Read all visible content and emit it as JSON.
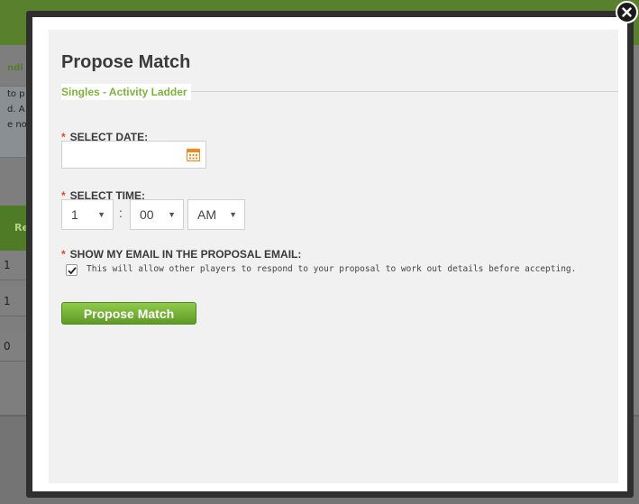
{
  "background": {
    "heading_fragment": "ndi",
    "text_fragments": [
      "to p",
      "d. A",
      "e no"
    ],
    "table_header_fragment": "Re",
    "row_values": [
      "1",
      "1",
      "0"
    ]
  },
  "modal": {
    "title": "Propose Match",
    "subtitle": "Singles - Activity Ladder",
    "date_label": "SELECT DATE:",
    "date_value": "",
    "time_label": "SELECT TIME:",
    "hour_value": "1",
    "minute_value": "00",
    "time_separator": ":",
    "ampm_value": "AM",
    "email_label": "SHOW MY EMAIL IN THE PROPOSAL EMAIL:",
    "email_checked": true,
    "email_note": "This will allow other players to respond to your proposal to work out details before accepting.",
    "submit_label": "Propose Match",
    "required_marker": "*",
    "arrow_glyph": "▼"
  },
  "colors": {
    "accent_green": "#7db33a",
    "button_green": "#6aaa2c",
    "required_red": "#e04a2b",
    "calendar_orange": "#f08a1e"
  },
  "icons": {
    "close": "close-icon",
    "calendar": "calendar-icon",
    "check": "checkmark-icon"
  }
}
